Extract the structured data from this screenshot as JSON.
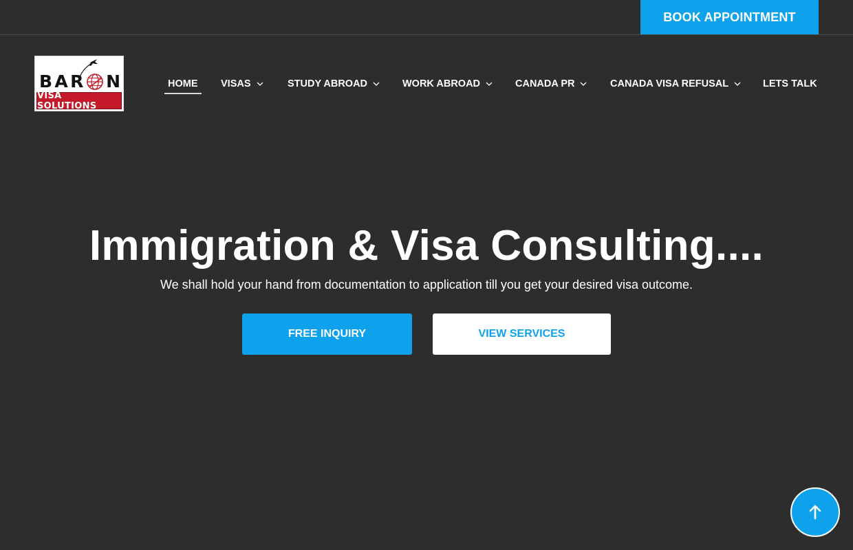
{
  "topbar": {
    "book_label": "BOOK APPOINTMENT"
  },
  "logo": {
    "brand_letters": [
      "B",
      "A",
      "R",
      "",
      "N"
    ],
    "tagline": "VISA SOLUTIONS",
    "colors": {
      "tag_bg": "#c41a2a",
      "text": "#111111"
    }
  },
  "nav": {
    "items": [
      {
        "label": "HOME",
        "active": true,
        "has_dropdown": false
      },
      {
        "label": "VISAS",
        "active": false,
        "has_dropdown": true
      },
      {
        "label": "STUDY ABROAD",
        "active": false,
        "has_dropdown": true
      },
      {
        "label": "WORK ABROAD",
        "active": false,
        "has_dropdown": true
      },
      {
        "label": "CANADA PR",
        "active": false,
        "has_dropdown": true
      },
      {
        "label": "CANADA VISA REFUSAL",
        "active": false,
        "has_dropdown": true
      },
      {
        "label": "LETS TALK",
        "active": false,
        "has_dropdown": false
      }
    ],
    "dropdown_icon": "chevron-down-icon"
  },
  "hero": {
    "title": "Immigration & Visa Consulting....",
    "subtitle": "We shall hold your hand from documentation to application till you get your desired visa outcome.",
    "primary_label": "FREE INQUIRY",
    "secondary_label": "VIEW SERVICES"
  },
  "scroll_top": {
    "icon": "arrow-up-icon"
  },
  "colors": {
    "accent": "#0ea2ec",
    "background": "#2d2d2d",
    "text": "#ffffff"
  }
}
